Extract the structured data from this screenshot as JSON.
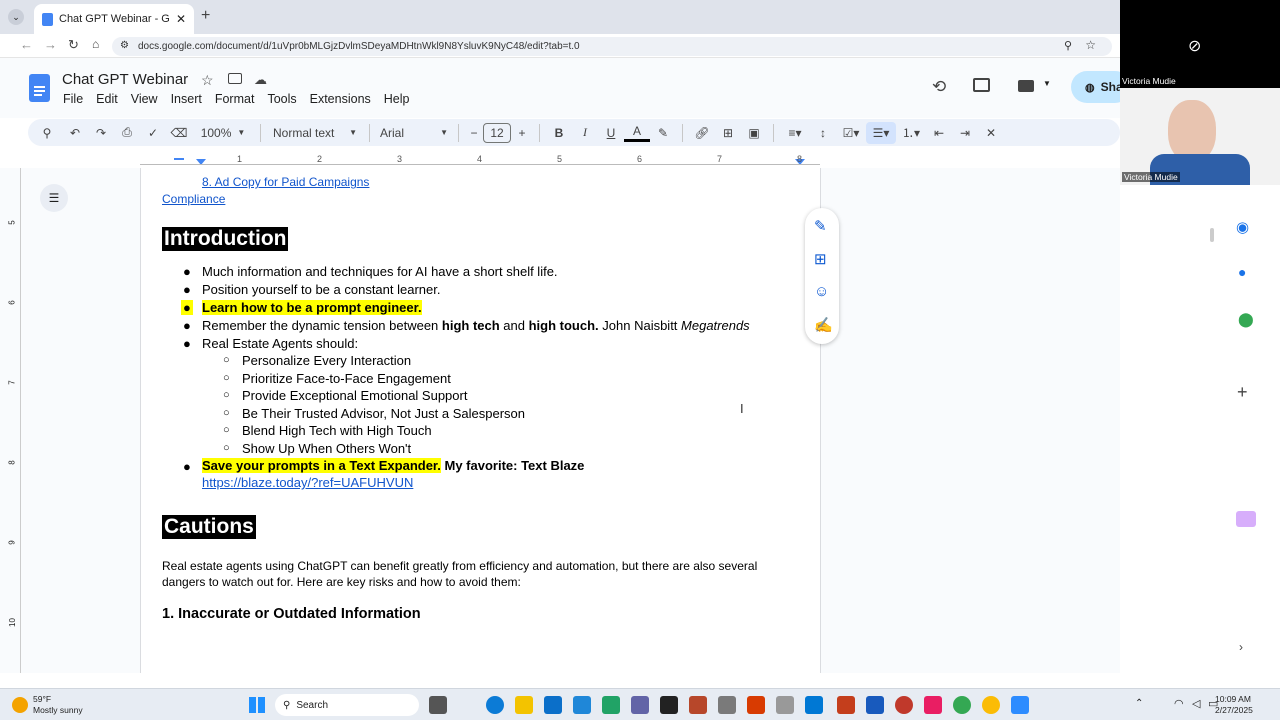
{
  "browser": {
    "tab_title": "Chat GPT Webinar - Google Do",
    "new_tab": "+",
    "url": "docs.google.com/document/d/1uVpr0bMLGjzDvlmSDeyaMDHtnWkl9N8YsluvK9NyC48/edit?tab=t.0"
  },
  "docs": {
    "title": "Chat GPT Webinar",
    "menu": [
      "File",
      "Edit",
      "View",
      "Insert",
      "Format",
      "Tools",
      "Extensions",
      "Help"
    ],
    "share_label": "Shar",
    "zoom": "100%",
    "style": "Normal text",
    "font": "Arial",
    "font_size": "12"
  },
  "ruler": [
    "1",
    "2",
    "3",
    "4",
    "5",
    "6",
    "7",
    "8"
  ],
  "vruler": [
    "5",
    "6",
    "7",
    "8",
    "9",
    "10"
  ],
  "content": {
    "toc_link": "8. Ad Copy for Paid Campaigns",
    "compliance": "Compliance",
    "intro_heading": "Introduction",
    "b1": "Much information and techniques for AI have a short shelf life.",
    "b2": "Position yourself to be a constant learner.",
    "b3": "Learn how to be a prompt engineer.",
    "b4_a": "Remember the dynamic tension between ",
    "b4_b": "high tech",
    "b4_c": " and ",
    "b4_d": "high touch.",
    "b4_e": " John Naisbitt ",
    "b4_f": "Megatrends",
    "b5": "Real Estate Agents should:",
    "sub": [
      "Personalize Every Interaction",
      "Prioritize Face-to-Face Engagement",
      "Provide Exceptional Emotional Support",
      "Be Their Trusted Advisor, Not Just a Salesperson",
      "Blend High Tech with High Touch",
      "Show Up When Others Won't"
    ],
    "b6_a": "Save your prompts in a Text Expander.",
    "b6_b": " My favorite: Text Blaze",
    "b6_link": "https://blaze.today/?ref=UAFUHVUN",
    "cautions_heading": "Cautions",
    "para": "Real estate agents using ChatGPT can benefit greatly from efficiency and automation, but there are also several dangers to watch out for. Here are key risks and how to avoid them:",
    "h3": "1. Inaccurate or Outdated Information"
  },
  "video": {
    "name_top": "Victoria Mudie",
    "name_bottom": "Victoria Mudie"
  },
  "taskbar": {
    "weather_temp": "59°F",
    "weather_desc": "Mostly sunny",
    "search": "Search",
    "time": "10:09 AM",
    "date": "2/27/2025"
  }
}
